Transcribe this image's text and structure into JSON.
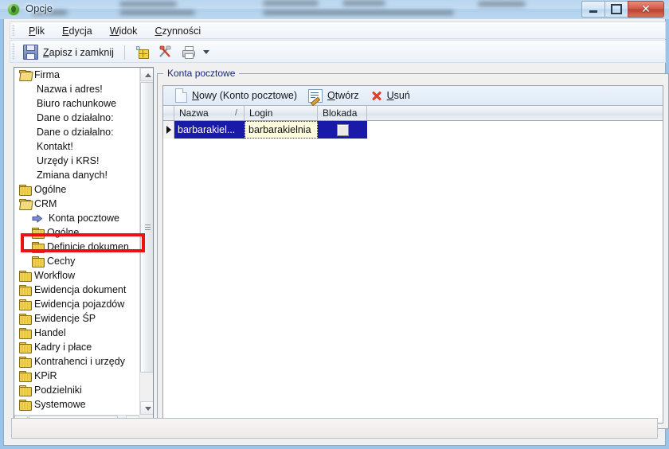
{
  "window": {
    "title": "Opcje",
    "icon": "app-globe-icon",
    "buttons": {
      "minimize": "minimize-icon",
      "maximize": "maximize-icon",
      "close": "✕"
    }
  },
  "menu": {
    "items": [
      {
        "accel": "P",
        "rest": "lik"
      },
      {
        "accel": "E",
        "rest": "dycja"
      },
      {
        "accel": "W",
        "rest": "idok"
      },
      {
        "accel": "C",
        "rest": "zynności"
      }
    ]
  },
  "toolbar": {
    "save_accel": "Z",
    "save_rest": "apisz i zamknij",
    "icons": [
      "grid-icon",
      "tools-icon",
      "printer-icon",
      "dropdown-caret-icon"
    ]
  },
  "tree": {
    "items": [
      {
        "label": "Firma",
        "icon": "folder-open-icon",
        "indent": 1
      },
      {
        "label": "Nazwa i adres!",
        "icon": "none",
        "indent": 2
      },
      {
        "label": "Biuro rachunkowe",
        "icon": "none",
        "indent": 2
      },
      {
        "label": "Dane o działalno:",
        "icon": "none",
        "indent": 2
      },
      {
        "label": "Dane o działalno:",
        "icon": "none",
        "indent": 2
      },
      {
        "label": "Kontakt!",
        "icon": "none",
        "indent": 2
      },
      {
        "label": "Urzędy i KRS!",
        "icon": "none",
        "indent": 2
      },
      {
        "label": "Zmiana danych!",
        "icon": "none",
        "indent": 2
      },
      {
        "label": "Ogólne",
        "icon": "folder-icon",
        "indent": 1
      },
      {
        "label": "CRM",
        "icon": "folder-open-icon",
        "indent": 1
      },
      {
        "label": "Konta pocztowe",
        "icon": "arrow-right-icon",
        "indent": 3,
        "highlighted": true
      },
      {
        "label": "Ogólne",
        "icon": "folder-icon",
        "indent": 3
      },
      {
        "label": "Definicje dokumen",
        "icon": "folder-icon",
        "indent": 3
      },
      {
        "label": "Cechy",
        "icon": "folder-icon",
        "indent": 3
      },
      {
        "label": "Workflow",
        "icon": "folder-icon",
        "indent": 1
      },
      {
        "label": "Ewidencja dokument",
        "icon": "folder-icon",
        "indent": 1
      },
      {
        "label": "Ewidencja pojazdów",
        "icon": "folder-icon",
        "indent": 1
      },
      {
        "label": "Ewidencje ŚP",
        "icon": "folder-icon",
        "indent": 1
      },
      {
        "label": "Handel",
        "icon": "folder-icon",
        "indent": 1
      },
      {
        "label": "Kadry i płace",
        "icon": "folder-icon",
        "indent": 1
      },
      {
        "label": "Kontrahenci i urzędy",
        "icon": "folder-icon",
        "indent": 1
      },
      {
        "label": "KPiR",
        "icon": "folder-icon",
        "indent": 1
      },
      {
        "label": "Podzielniki",
        "icon": "folder-icon",
        "indent": 1
      },
      {
        "label": "Systemowe",
        "icon": "folder-icon",
        "indent": 1
      }
    ],
    "highlight_color": "#ee1111"
  },
  "content": {
    "group_title": "Konta pocztowe",
    "actions": [
      {
        "label": "Nowy (Konto pocztowe)",
        "accel": "N",
        "rest": "owy (Konto pocztowe)",
        "icon": "new-document-icon"
      },
      {
        "label": "Otwórz",
        "accel": "O",
        "rest": "twórz",
        "icon": "open-document-icon"
      },
      {
        "label": "Usuń",
        "accel": "U",
        "rest": "suń",
        "icon": "delete-x-icon"
      }
    ],
    "grid": {
      "columns": [
        "Nazwa",
        "Login",
        "Blokada"
      ],
      "sort_indicator": "/",
      "rows": [
        {
          "nazwa": "barbarakiel...",
          "login": "barbarakielnia",
          "blokada": false,
          "selected": true,
          "editing_column": "Login"
        }
      ]
    }
  }
}
